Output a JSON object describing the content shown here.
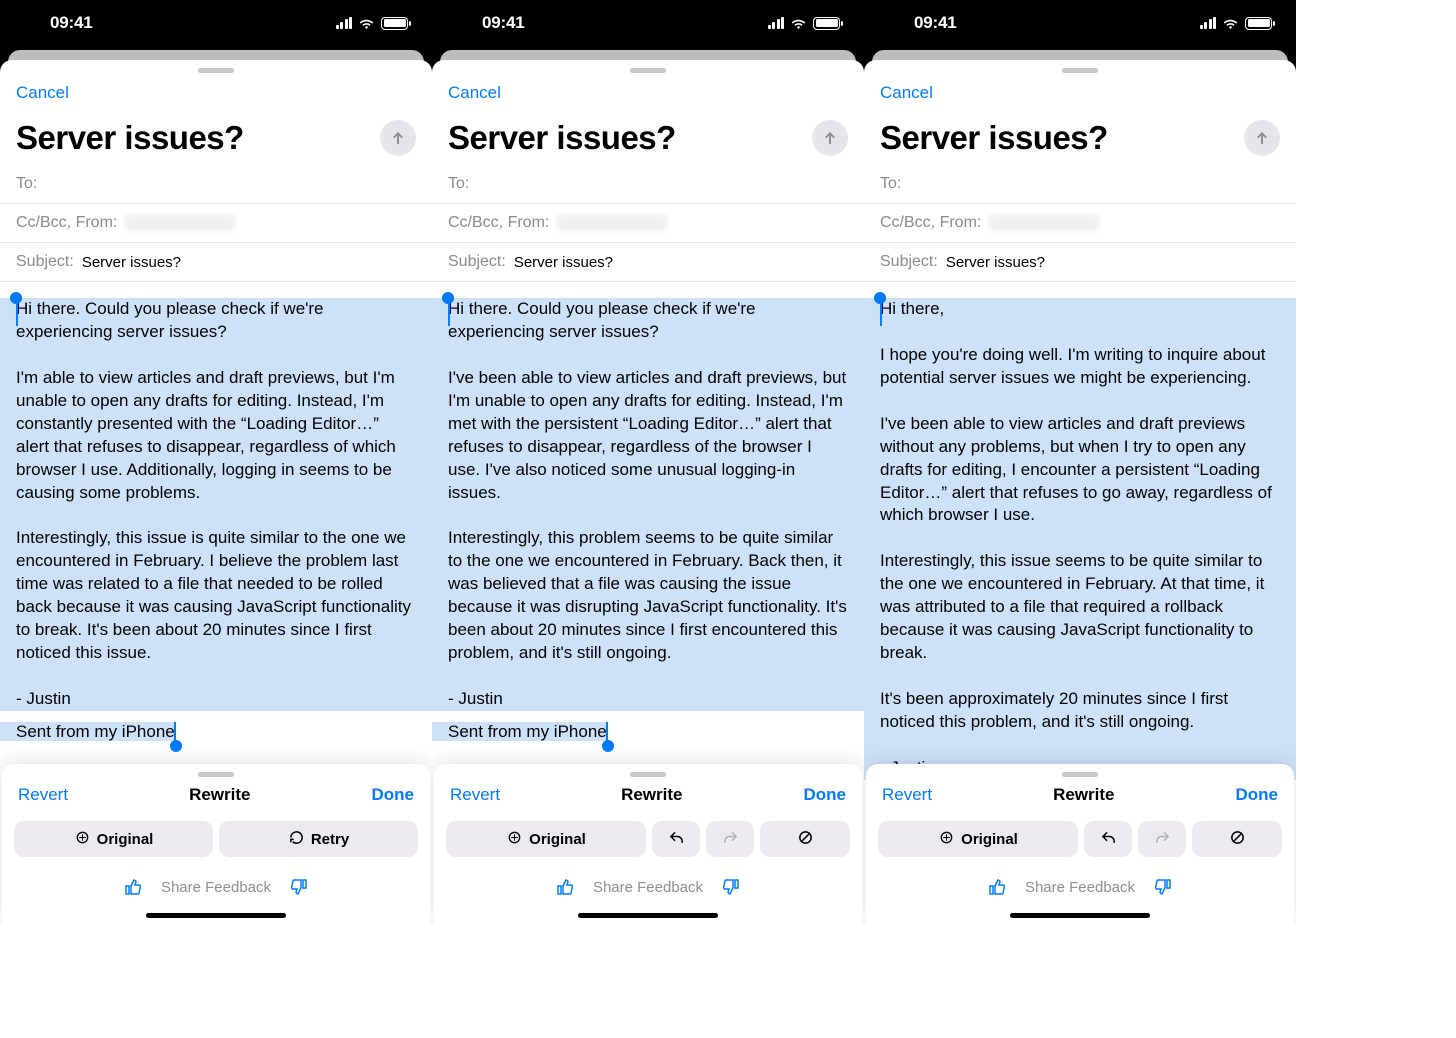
{
  "status": {
    "time": "09:41"
  },
  "sheet": {
    "cancel": "Cancel",
    "title": "Server issues?",
    "to_label": "To:",
    "ccbcc_label": "Cc/Bcc, From:",
    "subject_label": "Subject:",
    "subject_value": "Server issues?",
    "body_sent": "Sent from my iPhone"
  },
  "panes": [
    {
      "body": [
        "Hi there. Could you please check if we're experiencing server issues?",
        "",
        "I'm able to view articles and draft previews, but I'm unable to open any drafts for editing. Instead, I'm constantly presented with the “Loading Editor…” alert that refuses to disappear, regardless of which browser I use. Additionally, logging in seems to be causing some problems.",
        "",
        "Interestingly, this issue is quite similar to the one we encountered in February. I believe the problem last time was related to a file that needed to be rolled back because it was causing JavaScript functionality to break. It's been about 20 minutes since I first noticed this issue.",
        "",
        "- Justin"
      ],
      "variant": "original_retry"
    },
    {
      "body": [
        "Hi there. Could you please check if we're experiencing server issues?",
        "",
        "I've been able to view articles and draft previews, but I'm unable to open any drafts for editing. Instead, I'm met with the persistent “Loading Editor…” alert that refuses to disappear, regardless of the browser I use. I've also noticed some unusual logging-in issues.",
        "",
        "Interestingly, this problem seems to be quite similar to the one we encountered in February. Back then, it was believed that a file was causing the issue because it was disrupting JavaScript functionality. It's been about 20 minutes since I first encountered this problem, and it's still ongoing.",
        "",
        "- Justin"
      ],
      "variant": "original_undo"
    },
    {
      "body": [
        "Hi there,",
        "",
        "I hope you're doing well. I'm writing to inquire about potential server issues we might be experiencing.",
        "",
        "I've been able to view articles and draft previews without any problems, but when I try to open any drafts for editing, I encounter a persistent “Loading Editor…” alert that refuses to go away, regardless of which browser I use.",
        "",
        "Interestingly, this issue seems to be quite similar to the one we encountered in February. At that time, it was attributed to a file that required a rollback because it was causing JavaScript functionality to break.",
        "",
        "It's been approximately 20 minutes since I first noticed this problem, and it's still ongoing.",
        "",
        "- Justin"
      ],
      "variant": "original_undo"
    }
  ],
  "rewrite": {
    "revert": "Revert",
    "title": "Rewrite",
    "done": "Done",
    "original": "Original",
    "retry": "Retry",
    "feedback": "Share Feedback"
  }
}
